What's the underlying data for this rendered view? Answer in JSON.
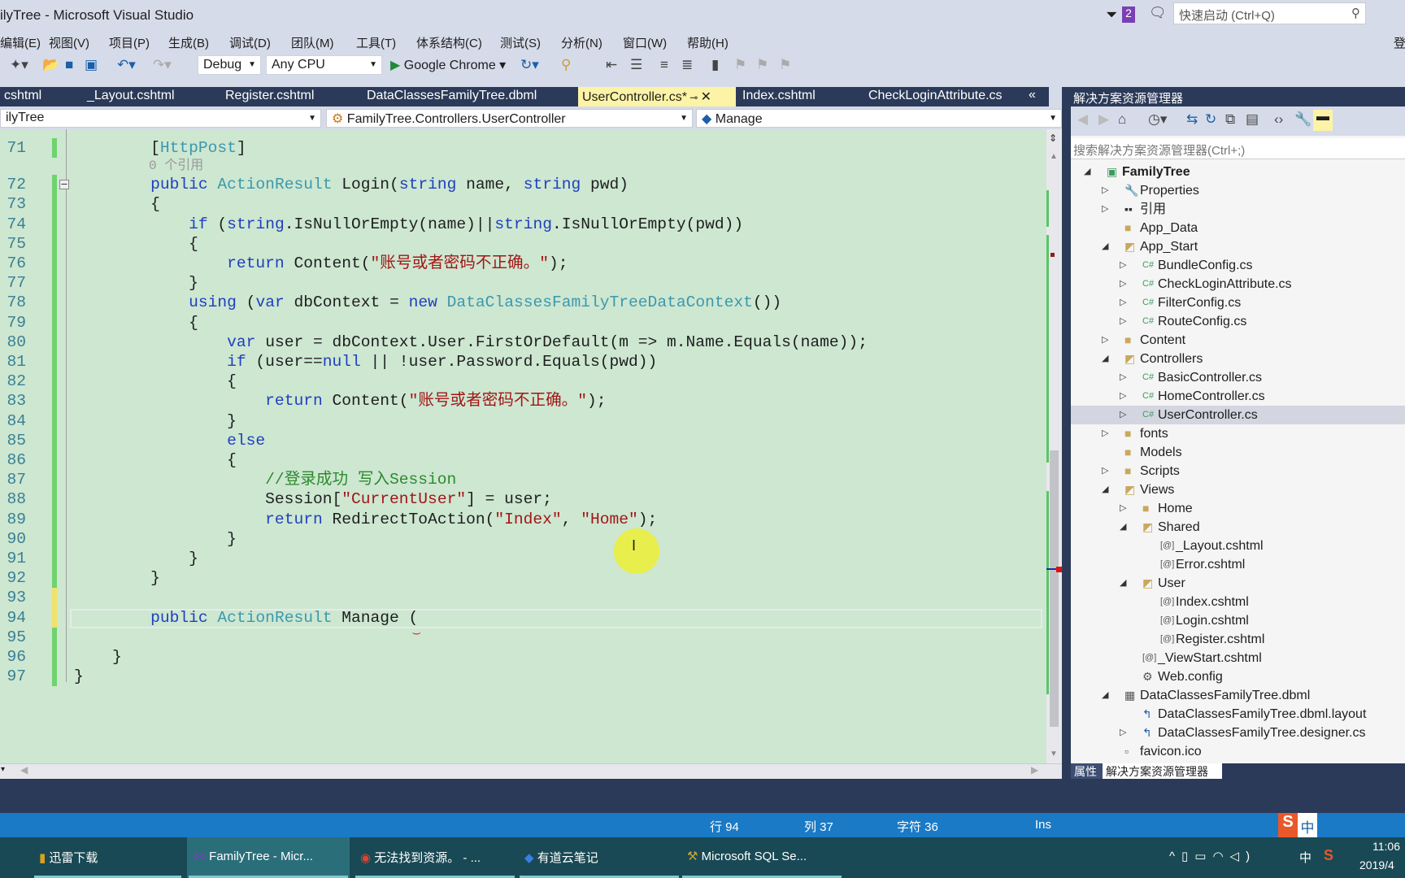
{
  "window": {
    "title": "ilyTree - Microsoft Visual Studio",
    "notif_count": "2",
    "quick_launch_placeholder": "快速启动 (Ctrl+Q)",
    "login": "登"
  },
  "menu": [
    "编辑(E)",
    "视图(V)",
    "项目(P)",
    "生成(B)",
    "调试(D)",
    "团队(M)",
    "工具(T)",
    "体系结构(C)",
    "测试(S)",
    "分析(N)",
    "窗口(W)",
    "帮助(H)"
  ],
  "toolbar": {
    "config": "Debug",
    "platform": "Any CPU",
    "run_target": "Google Chrome"
  },
  "tabs": [
    {
      "label": "cshtml"
    },
    {
      "label": "_Layout.cshtml"
    },
    {
      "label": "Register.cshtml"
    },
    {
      "label": "DataClassesFamilyTree.dbml"
    },
    {
      "label": "UserController.cs*",
      "active": true
    },
    {
      "label": "Index.cshtml"
    },
    {
      "label": "CheckLoginAttribute.cs"
    }
  ],
  "nav": {
    "project": "ilyTree",
    "class": "FamilyTree.Controllers.UserController",
    "member": "Manage"
  },
  "code": {
    "codelens": "0 个引用",
    "lines": [
      {
        "n": "71",
        "t": [
          [
            "        ",
            "pl"
          ],
          [
            "[",
            "pl"
          ],
          [
            "HttpPost",
            "attr"
          ],
          [
            "]",
            "pl"
          ]
        ]
      },
      {
        "n": "72",
        "t": [
          [
            "        ",
            "pl"
          ],
          [
            "public ",
            "kw"
          ],
          [
            "ActionResult ",
            "ty"
          ],
          [
            "Login(",
            "pl"
          ],
          [
            "string ",
            "kw"
          ],
          [
            "name, ",
            "pl"
          ],
          [
            "string ",
            "kw"
          ],
          [
            "pwd)",
            "pl"
          ]
        ]
      },
      {
        "n": "73",
        "t": [
          [
            "        {",
            "pl"
          ]
        ]
      },
      {
        "n": "74",
        "t": [
          [
            "            ",
            "pl"
          ],
          [
            "if ",
            "kw"
          ],
          [
            "(",
            "pl"
          ],
          [
            "string",
            "kw"
          ],
          [
            ".IsNullOrEmpty(name)||",
            "pl"
          ],
          [
            "string",
            "kw"
          ],
          [
            ".IsNullOrEmpty(pwd))",
            "pl"
          ]
        ]
      },
      {
        "n": "75",
        "t": [
          [
            "            {",
            "pl"
          ]
        ]
      },
      {
        "n": "76",
        "t": [
          [
            "                ",
            "pl"
          ],
          [
            "return ",
            "kw"
          ],
          [
            "Content(",
            "pl"
          ],
          [
            "\"账号或者密码不正确。\"",
            "str"
          ],
          [
            ");",
            "pl"
          ]
        ]
      },
      {
        "n": "77",
        "t": [
          [
            "            }",
            "pl"
          ]
        ]
      },
      {
        "n": "78",
        "t": [
          [
            "            ",
            "pl"
          ],
          [
            "using ",
            "kw"
          ],
          [
            "(",
            "pl"
          ],
          [
            "var ",
            "kw"
          ],
          [
            "dbContext = ",
            "pl"
          ],
          [
            "new ",
            "kw"
          ],
          [
            "DataClassesFamilyTreeDataContext",
            "ty"
          ],
          [
            "())",
            "pl"
          ]
        ]
      },
      {
        "n": "79",
        "t": [
          [
            "            {",
            "pl"
          ]
        ]
      },
      {
        "n": "80",
        "t": [
          [
            "                ",
            "pl"
          ],
          [
            "var ",
            "kw"
          ],
          [
            "user = dbContext.User.FirstOrDefault(m => m.Name.Equals(name));",
            "pl"
          ]
        ]
      },
      {
        "n": "81",
        "t": [
          [
            "                ",
            "pl"
          ],
          [
            "if ",
            "kw"
          ],
          [
            "(user==",
            "pl"
          ],
          [
            "null ",
            "kw"
          ],
          [
            "|| !user.Password.Equals(pwd))",
            "pl"
          ]
        ]
      },
      {
        "n": "82",
        "t": [
          [
            "                {",
            "pl"
          ]
        ]
      },
      {
        "n": "83",
        "t": [
          [
            "                    ",
            "pl"
          ],
          [
            "return ",
            "kw"
          ],
          [
            "Content(",
            "pl"
          ],
          [
            "\"账号或者密码不正确。\"",
            "str"
          ],
          [
            ");",
            "pl"
          ]
        ]
      },
      {
        "n": "84",
        "t": [
          [
            "                }",
            "pl"
          ]
        ]
      },
      {
        "n": "85",
        "t": [
          [
            "                ",
            "pl"
          ],
          [
            "else",
            "kw"
          ]
        ]
      },
      {
        "n": "86",
        "t": [
          [
            "                {",
            "pl"
          ]
        ]
      },
      {
        "n": "87",
        "t": [
          [
            "                    ",
            "pl"
          ],
          [
            "//登录成功 写入Session",
            "cm"
          ]
        ]
      },
      {
        "n": "88",
        "t": [
          [
            "                    Session[",
            "pl"
          ],
          [
            "\"CurrentUser\"",
            "str"
          ],
          [
            "] = user;",
            "pl"
          ]
        ]
      },
      {
        "n": "89",
        "t": [
          [
            "                    ",
            "pl"
          ],
          [
            "return ",
            "kw"
          ],
          [
            "RedirectToAction(",
            "pl"
          ],
          [
            "\"Index\"",
            "str"
          ],
          [
            ", ",
            "pl"
          ],
          [
            "\"Home\"",
            "str"
          ],
          [
            ");",
            "pl"
          ]
        ]
      },
      {
        "n": "90",
        "t": [
          [
            "                }",
            "pl"
          ]
        ]
      },
      {
        "n": "91",
        "t": [
          [
            "            }",
            "pl"
          ]
        ]
      },
      {
        "n": "92",
        "t": [
          [
            "        }",
            "pl"
          ]
        ]
      },
      {
        "n": "93",
        "t": []
      },
      {
        "n": "94",
        "t": [
          [
            "        ",
            "pl"
          ],
          [
            "public ",
            "kw"
          ],
          [
            "ActionResult ",
            "ty"
          ],
          [
            "Manage (",
            "pl"
          ]
        ]
      },
      {
        "n": "95",
        "t": []
      },
      {
        "n": "96",
        "t": [
          [
            "    }",
            "pl"
          ]
        ]
      },
      {
        "n": "97",
        "t": [
          [
            "}",
            "pl"
          ]
        ]
      }
    ]
  },
  "solution_explorer": {
    "title": "解决方案资源管理器",
    "search_placeholder": "搜索解决方案资源管理器(Ctrl+;)",
    "items": [
      {
        "label": "FamilyTree",
        "level": 0,
        "exp": "open",
        "icon": "project-icon",
        "bold": true
      },
      {
        "label": "Properties",
        "level": 1,
        "exp": "closed",
        "icon": "wrench-icon"
      },
      {
        "label": "引用",
        "level": 1,
        "exp": "closed",
        "icon": "references-icon"
      },
      {
        "label": "App_Data",
        "level": 1,
        "exp": "",
        "icon": "folder-icon"
      },
      {
        "label": "App_Start",
        "level": 1,
        "exp": "open",
        "icon": "folder-open-icon"
      },
      {
        "label": "BundleConfig.cs",
        "level": 2,
        "exp": "closed",
        "icon": "csharp-file-icon"
      },
      {
        "label": "CheckLoginAttribute.cs",
        "level": 2,
        "exp": "closed",
        "icon": "csharp-file-icon"
      },
      {
        "label": "FilterConfig.cs",
        "level": 2,
        "exp": "closed",
        "icon": "csharp-file-icon"
      },
      {
        "label": "RouteConfig.cs",
        "level": 2,
        "exp": "closed",
        "icon": "csharp-file-icon"
      },
      {
        "label": "Content",
        "level": 1,
        "exp": "closed",
        "icon": "folder-icon"
      },
      {
        "label": "Controllers",
        "level": 1,
        "exp": "open",
        "icon": "folder-open-icon"
      },
      {
        "label": "BasicController.cs",
        "level": 2,
        "exp": "closed",
        "icon": "csharp-file-icon"
      },
      {
        "label": "HomeController.cs",
        "level": 2,
        "exp": "closed",
        "icon": "csharp-file-icon"
      },
      {
        "label": "UserController.cs",
        "level": 2,
        "exp": "closed",
        "icon": "csharp-file-icon",
        "selected": true
      },
      {
        "label": "fonts",
        "level": 1,
        "exp": "closed",
        "icon": "folder-icon"
      },
      {
        "label": "Models",
        "level": 1,
        "exp": "",
        "icon": "folder-icon"
      },
      {
        "label": "Scripts",
        "level": 1,
        "exp": "closed",
        "icon": "folder-icon"
      },
      {
        "label": "Views",
        "level": 1,
        "exp": "open",
        "icon": "folder-open-icon"
      },
      {
        "label": "Home",
        "level": 2,
        "exp": "closed",
        "icon": "folder-icon"
      },
      {
        "label": "Shared",
        "level": 2,
        "exp": "open",
        "icon": "folder-open-icon"
      },
      {
        "label": "_Layout.cshtml",
        "level": 3,
        "exp": "",
        "icon": "razor-file-icon"
      },
      {
        "label": "Error.cshtml",
        "level": 3,
        "exp": "",
        "icon": "razor-file-icon"
      },
      {
        "label": "User",
        "level": 2,
        "exp": "open",
        "icon": "folder-open-icon"
      },
      {
        "label": "Index.cshtml",
        "level": 3,
        "exp": "",
        "icon": "razor-file-icon"
      },
      {
        "label": "Login.cshtml",
        "level": 3,
        "exp": "",
        "icon": "razor-file-icon"
      },
      {
        "label": "Register.cshtml",
        "level": 3,
        "exp": "",
        "icon": "razor-file-icon"
      },
      {
        "label": "_ViewStart.cshtml",
        "level": 2,
        "exp": "",
        "icon": "razor-file-icon"
      },
      {
        "label": "Web.config",
        "level": 2,
        "exp": "",
        "icon": "config-file-icon"
      },
      {
        "label": "DataClassesFamilyTree.dbml",
        "level": 1,
        "exp": "open",
        "icon": "dbml-icon"
      },
      {
        "label": "DataClassesFamilyTree.dbml.layout",
        "level": 2,
        "exp": "",
        "icon": "layout-file-icon"
      },
      {
        "label": "DataClassesFamilyTree.designer.cs",
        "level": 2,
        "exp": "closed",
        "icon": "layout-file-icon"
      },
      {
        "label": "favicon.ico",
        "level": 1,
        "exp": "",
        "icon": "image-file-icon"
      }
    ],
    "bottom_tabs": [
      "属性",
      "解决方案资源管理器"
    ]
  },
  "status": {
    "line": "行 94",
    "col": "列 37",
    "char": "字符 36",
    "mode": "Ins",
    "ime": "中"
  },
  "taskbar": {
    "items": [
      "迅雷下载",
      "FamilyTree - Micr...",
      "无法找到资源。 - ...",
      "有道云笔记",
      "Microsoft SQL Se..."
    ],
    "tray_ime": "中",
    "time": "11:06",
    "date": "2019/4"
  },
  "colors": {
    "accent": "#1a7ac6",
    "editor_bg": "#cde7d1",
    "tab_active": "#fdf3a6",
    "chrome_dark": "#2b3a58"
  }
}
